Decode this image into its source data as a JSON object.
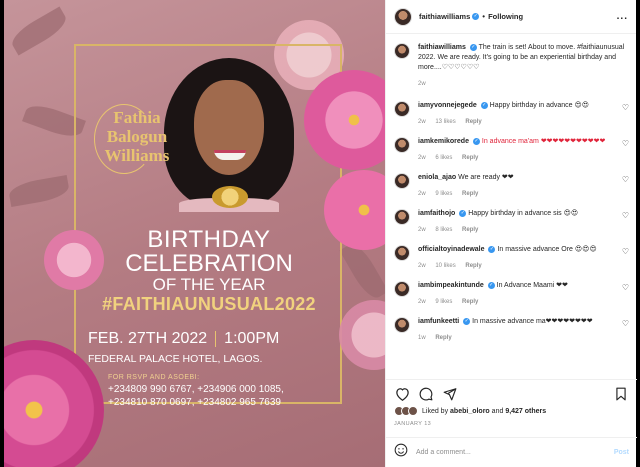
{
  "flyer": {
    "logo_line1": "Fathia",
    "logo_line2": "Balogun",
    "logo_line3": "Williams",
    "title_line1": "BIRTHDAY",
    "title_line2": "CELEBRATION",
    "subtitle": "OF THE YEAR",
    "hashtag": "#FAITHIAUNUSUAL2022",
    "date": "FEB. 27TH 2022",
    "time": "1:00PM",
    "venue": "FEDERAL PALACE HOTEL, LAGOS.",
    "rsvp_label": "FOR RSVP AND ASOEBI:",
    "phones_line1": "+234809 990 6767, +234906 000 1085,",
    "phones_line2": "+234810 870 0697, +234802 965 7639"
  },
  "header": {
    "username": "faithiawilliams",
    "follow_label": "Following",
    "more_label": "..."
  },
  "caption": {
    "username": "faithiawilliams",
    "text": "The train is set! About to move. #faithiaunusual 2022. We are ready. It's going to be an experiential birthday and more....♡♡♡♡♡♡",
    "time": "2w"
  },
  "comments": [
    {
      "username": "iamyvonnejegede",
      "text": "Happy birthday in advance 😍😍",
      "time": "2w",
      "likes": "13 likes",
      "reply": "Reply"
    },
    {
      "username": "iamkemikorede",
      "text": "In advance ma'am ❤❤❤❤❤❤❤❤❤❤❤",
      "time": "2w",
      "likes": "6 likes",
      "reply": "Reply"
    },
    {
      "username": "eniola_ajao",
      "text": "We are ready ❤❤",
      "time": "2w",
      "likes": "9 likes",
      "reply": "Reply"
    },
    {
      "username": "iamfaithojo",
      "text": "Happy birthday in advance sis 😍😍",
      "time": "2w",
      "likes": "8 likes",
      "reply": "Reply"
    },
    {
      "username": "officialtoyinadewale",
      "text": "In massive advance Ore 😍😍😍",
      "time": "2w",
      "likes": "10 likes",
      "reply": "Reply"
    },
    {
      "username": "iambimpeakintunde",
      "text": "In Advance Maami ❤❤",
      "time": "2w",
      "likes": "9 likes",
      "reply": "Reply"
    },
    {
      "username": "iamfunkeetti",
      "text": "In massive advance ma❤❤❤❤❤❤❤❤",
      "time": "1w",
      "likes": "",
      "reply": "Reply"
    }
  ],
  "likes_text_prefix": "Liked by",
  "likes_user": "abebi_oloro",
  "likes_and": "and",
  "likes_count": "9,427 others",
  "date": "JANUARY 13",
  "add_comment_placeholder": "Add a comment...",
  "post_label": "Post",
  "icons": [
    "heart-icon",
    "comment-icon",
    "share-icon",
    "bookmark-icon",
    "emoji-icon",
    "verified-icon"
  ]
}
